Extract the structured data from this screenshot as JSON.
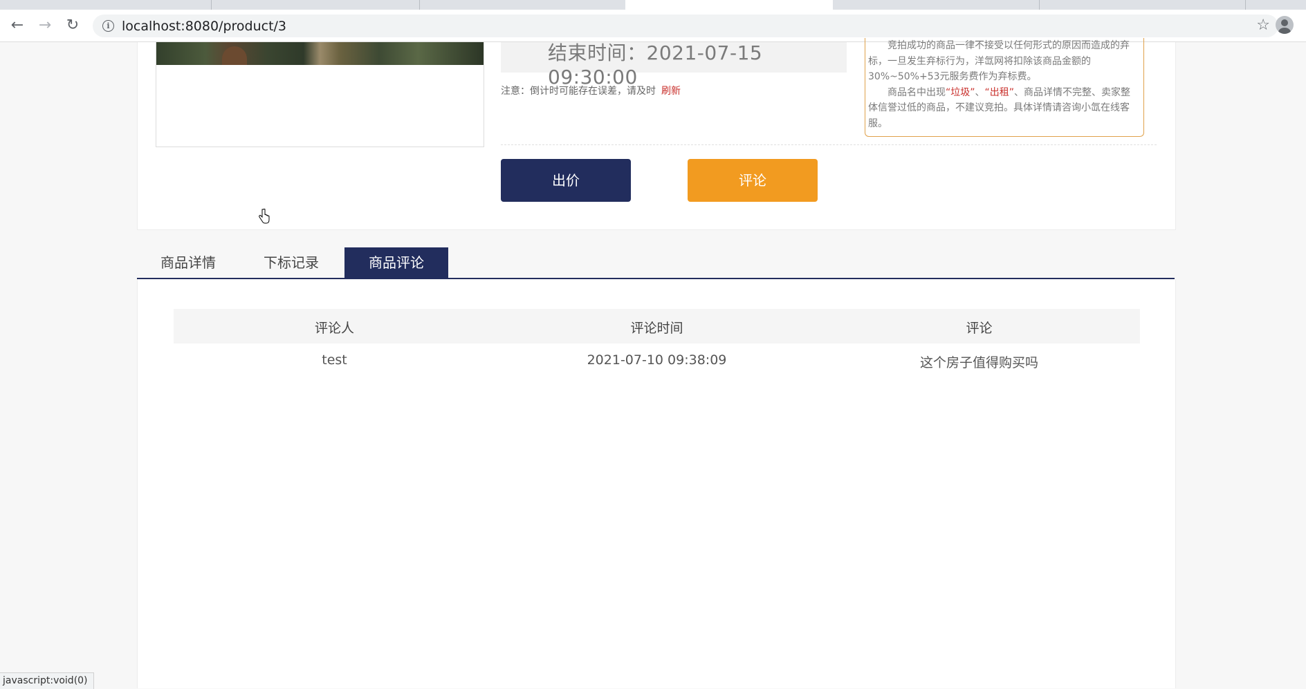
{
  "browser": {
    "url": "localhost:8080/product/3"
  },
  "product": {
    "end_time": "结束时间：2021-07-15 09:30:00",
    "notice_text": "注意：倒计时可能存在误差，请及时",
    "refresh_link": "刷新",
    "rules": {
      "p1": "竞拍成功的商品一律不接受以任何形式的原因而造成的弃标，一旦发生弃标行为，洋氙网将扣除该商品金额的30%~50%+53元服务费作为弃标费。",
      "p2_pre": "商品名中出现",
      "p2_hl1": "“垃圾”",
      "p2_sep": "、",
      "p2_hl2": "“出租”",
      "p2_post": "、商品详情不完整、卖家整体信誉过低的商品，不建议竞拍。具体详情请咨询小氙在线客服。"
    },
    "bid_button": "出价",
    "comment_button": "评论",
    "colors": {
      "primary": "#222d5d",
      "accent": "#f29b20",
      "highlight": "#c9302c"
    }
  },
  "tabs": [
    {
      "label": "商品详情"
    },
    {
      "label": "下标记录"
    },
    {
      "label": "商品评论"
    }
  ],
  "comments_table": {
    "headers": [
      "评论人",
      "评论时间",
      "评论"
    ],
    "rows": [
      [
        "test",
        "2021-07-10 09:38:09",
        "这个房子值得购买吗"
      ]
    ]
  },
  "status_bar": "javascript:void(0)"
}
